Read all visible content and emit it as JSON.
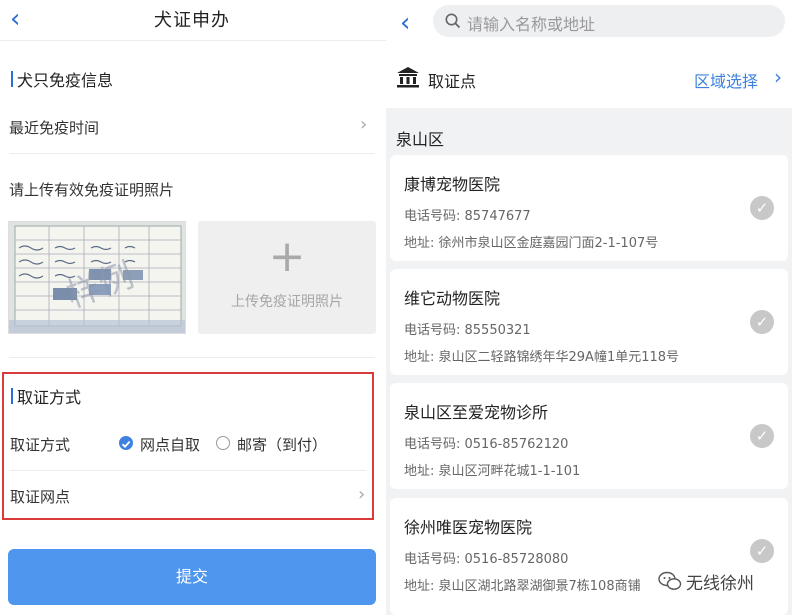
{
  "colors": {
    "accent": "#2b6ed6",
    "submit": "#4f96ee",
    "highlight_border": "#d93a3a"
  },
  "left": {
    "header": {
      "back_icon": "‹",
      "title": "犬证申办"
    },
    "immune_section": {
      "title": "犬只免疫信息"
    },
    "recent_immune": {
      "label": "最近免疫时间",
      "chevron": "›"
    },
    "upload_prompt": "请上传有效免疫证明照片",
    "photo": {
      "watermark": "样例"
    },
    "upload_box": {
      "plus": "+",
      "label": "上传免疫证明照片"
    },
    "pickup_section": {
      "title": "取证方式",
      "method": {
        "label": "取证方式",
        "option_self": "网点自取",
        "option_mail": "邮寄（到付）",
        "selected": "网点自取"
      },
      "outlet": {
        "label": "取证网点",
        "chevron": "›"
      }
    },
    "submit_label": "提交"
  },
  "right": {
    "back_icon": "‹",
    "search": {
      "placeholder": "请输入名称或地址"
    },
    "header": {
      "title": "取证点",
      "region_select": "区域选择",
      "chevron": "›"
    },
    "district": "泉山区",
    "items": [
      {
        "name": "康博宠物医院",
        "phone": "电话号码:  85747677",
        "address": "地址:  徐州市泉山区金庭嘉园门面2-1-107号"
      },
      {
        "name": "维它动物医院",
        "phone": "电话号码:  85550321",
        "address": "地址:  泉山区二轻路锦绣年华29A幢1单元118号"
      },
      {
        "name": "泉山区至爱宠物诊所",
        "phone": "电话号码:  0516-85762120",
        "address": "地址:  泉山区河畔花城1-1-101"
      },
      {
        "name": "徐州唯医宠物医院",
        "phone": "电话号码:  0516-85728080",
        "address": "地址:  泉山区湖北路翠湖御景7栋108商铺"
      }
    ],
    "watermark_brand": "无线徐州"
  }
}
